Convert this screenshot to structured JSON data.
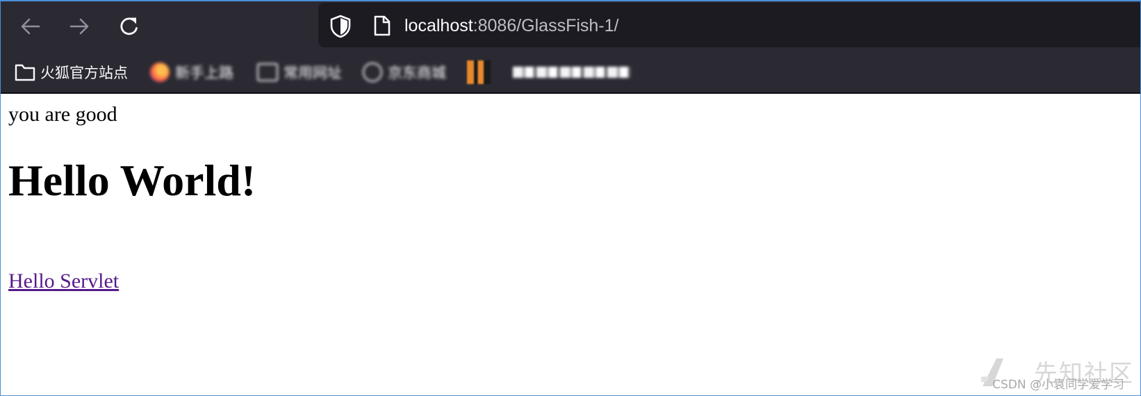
{
  "browser": {
    "url_host": "localhost",
    "url_rest": ":8086/GlassFish-1/",
    "icons": {
      "back": "arrow-left-icon",
      "forward": "arrow-right-icon",
      "reload": "reload-icon",
      "tracking": "shield-icon",
      "page": "page-icon",
      "folder": "folder-icon"
    },
    "bookmarks": [
      {
        "label": "火狐官方站点"
      },
      {
        "label": "新手上路"
      },
      {
        "label": "常用网址"
      },
      {
        "label": "京东商城"
      }
    ]
  },
  "page": {
    "greeting": "you are good",
    "heading": "Hello World!",
    "link_text": "Hello Servlet"
  },
  "watermark": {
    "site": "先知社区",
    "credit": "CSDN @小袁同学爱学习"
  },
  "colors": {
    "toolbar_bg": "#2b2a33",
    "urlbar_bg": "#1c1b22",
    "visited_link": "#551a8b"
  }
}
